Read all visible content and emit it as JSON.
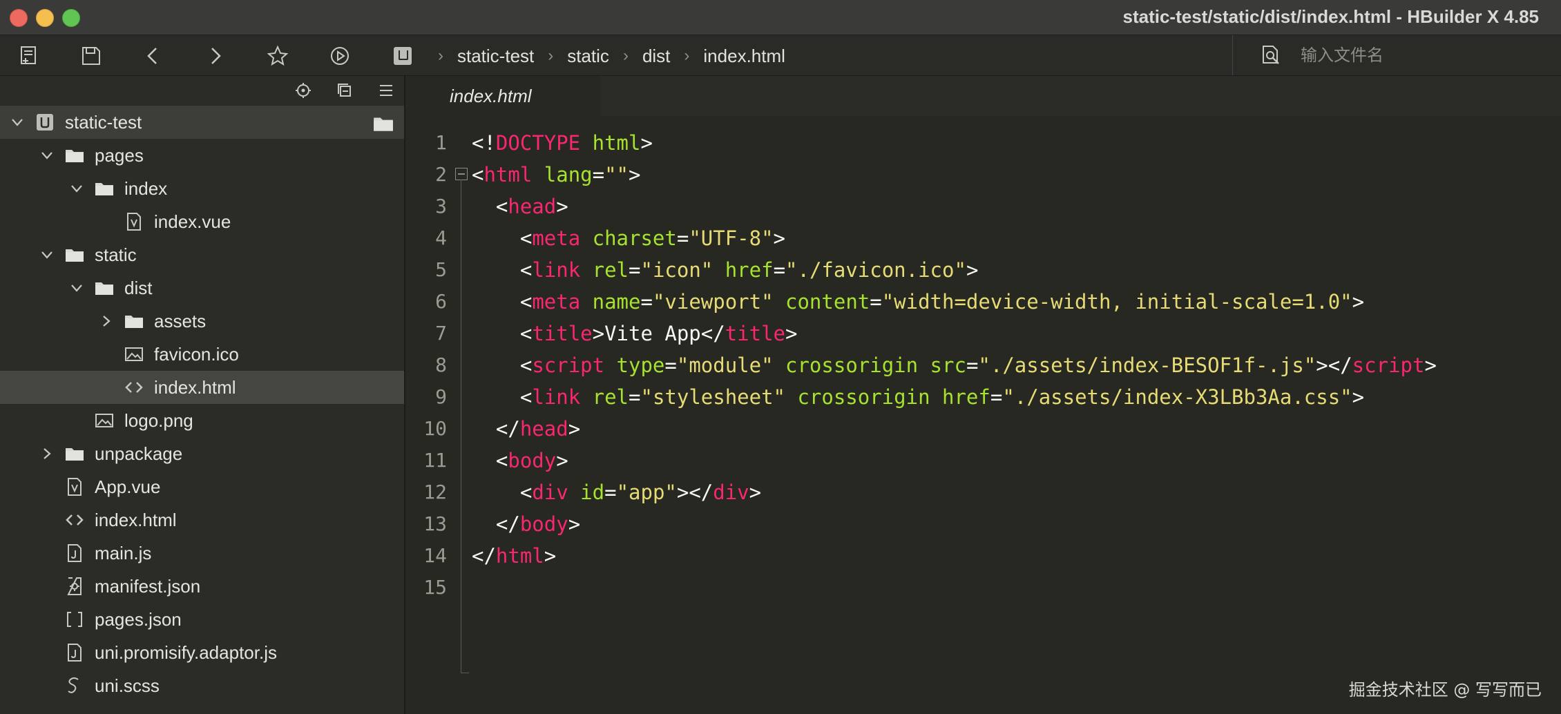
{
  "window": {
    "title": "static-test/static/dist/index.html - HBuilder X 4.85"
  },
  "toolbar": {
    "buttons": [
      "new-file-icon",
      "save-icon",
      "back-icon",
      "forward-icon",
      "star-icon",
      "run-icon"
    ],
    "breadcrumb": [
      "static-test",
      "static",
      "dist",
      "index.html"
    ],
    "search_placeholder": "输入文件名"
  },
  "sidebar": {
    "tree": [
      {
        "label": "static-test",
        "depth": 0,
        "type": "project",
        "expanded": true
      },
      {
        "label": "pages",
        "depth": 1,
        "type": "folder",
        "expanded": true
      },
      {
        "label": "index",
        "depth": 2,
        "type": "folder",
        "expanded": true
      },
      {
        "label": "index.vue",
        "depth": 3,
        "type": "vue"
      },
      {
        "label": "static",
        "depth": 1,
        "type": "folder",
        "expanded": true
      },
      {
        "label": "dist",
        "depth": 2,
        "type": "folder",
        "expanded": true
      },
      {
        "label": "assets",
        "depth": 3,
        "type": "folder",
        "expanded": false
      },
      {
        "label": "favicon.ico",
        "depth": 3,
        "type": "image"
      },
      {
        "label": "index.html",
        "depth": 3,
        "type": "html",
        "selected": true
      },
      {
        "label": "logo.png",
        "depth": 2,
        "type": "image"
      },
      {
        "label": "unpackage",
        "depth": 1,
        "type": "folder",
        "expanded": false
      },
      {
        "label": "App.vue",
        "depth": 1,
        "type": "vue"
      },
      {
        "label": "index.html",
        "depth": 1,
        "type": "html"
      },
      {
        "label": "main.js",
        "depth": 1,
        "type": "js"
      },
      {
        "label": "manifest.json",
        "depth": 1,
        "type": "manifest"
      },
      {
        "label": "pages.json",
        "depth": 1,
        "type": "json"
      },
      {
        "label": "uni.promisify.adaptor.js",
        "depth": 1,
        "type": "js"
      },
      {
        "label": "uni.scss",
        "depth": 1,
        "type": "scss"
      }
    ]
  },
  "editor": {
    "tab_label": "index.html",
    "line_numbers": [
      "1",
      "2",
      "3",
      "4",
      "5",
      "6",
      "7",
      "8",
      "9",
      "10",
      "11",
      "12",
      "13",
      "14",
      "15"
    ],
    "lines": [
      {
        "indent": 0,
        "tokens": [
          [
            "p",
            "<!"
          ],
          [
            "tg",
            "DOCTYPE"
          ],
          [
            "p",
            " "
          ],
          [
            "at",
            "html"
          ],
          [
            "p",
            ">"
          ]
        ]
      },
      {
        "indent": 0,
        "tokens": [
          [
            "p",
            "<"
          ],
          [
            "tg",
            "html"
          ],
          [
            "p",
            " "
          ],
          [
            "at",
            "lang"
          ],
          [
            "p",
            "="
          ],
          [
            "sv",
            "\"\""
          ],
          [
            "p",
            ">"
          ]
        ]
      },
      {
        "indent": 1,
        "tokens": [
          [
            "p",
            "<"
          ],
          [
            "tg",
            "head"
          ],
          [
            "p",
            ">"
          ]
        ]
      },
      {
        "indent": 2,
        "tokens": [
          [
            "p",
            "<"
          ],
          [
            "tg",
            "meta"
          ],
          [
            "p",
            " "
          ],
          [
            "at",
            "charset"
          ],
          [
            "p",
            "="
          ],
          [
            "sv",
            "\"UTF-8\""
          ],
          [
            "p",
            ">"
          ]
        ]
      },
      {
        "indent": 2,
        "tokens": [
          [
            "p",
            "<"
          ],
          [
            "tg",
            "link"
          ],
          [
            "p",
            " "
          ],
          [
            "at",
            "rel"
          ],
          [
            "p",
            "="
          ],
          [
            "sv",
            "\"icon\""
          ],
          [
            "p",
            " "
          ],
          [
            "at",
            "href"
          ],
          [
            "p",
            "="
          ],
          [
            "sv",
            "\"./favicon.ico\""
          ],
          [
            "p",
            ">"
          ]
        ]
      },
      {
        "indent": 2,
        "tokens": [
          [
            "p",
            "<"
          ],
          [
            "tg",
            "meta"
          ],
          [
            "p",
            " "
          ],
          [
            "at",
            "name"
          ],
          [
            "p",
            "="
          ],
          [
            "sv",
            "\"viewport\""
          ],
          [
            "p",
            " "
          ],
          [
            "at",
            "content"
          ],
          [
            "p",
            "="
          ],
          [
            "sv",
            "\"width=device-width, initial-scale=1.0\""
          ],
          [
            "p",
            ">"
          ]
        ]
      },
      {
        "indent": 2,
        "tokens": [
          [
            "p",
            "<"
          ],
          [
            "tg",
            "title"
          ],
          [
            "p",
            ">Vite App</"
          ],
          [
            "tg",
            "title"
          ],
          [
            "p",
            ">"
          ]
        ]
      },
      {
        "indent": 2,
        "tokens": [
          [
            "p",
            "<"
          ],
          [
            "tg",
            "script"
          ],
          [
            "p",
            " "
          ],
          [
            "at",
            "type"
          ],
          [
            "p",
            "="
          ],
          [
            "sv",
            "\"module\""
          ],
          [
            "p",
            " "
          ],
          [
            "at",
            "crossorigin"
          ],
          [
            "p",
            " "
          ],
          [
            "at",
            "src"
          ],
          [
            "p",
            "="
          ],
          [
            "sv",
            "\"./assets/index-BESOF1f-.js\""
          ],
          [
            "p",
            "></"
          ],
          [
            "tg",
            "script"
          ],
          [
            "p",
            ">"
          ]
        ]
      },
      {
        "indent": 2,
        "tokens": [
          [
            "p",
            "<"
          ],
          [
            "tg",
            "link"
          ],
          [
            "p",
            " "
          ],
          [
            "at",
            "rel"
          ],
          [
            "p",
            "="
          ],
          [
            "sv",
            "\"stylesheet\""
          ],
          [
            "p",
            " "
          ],
          [
            "at",
            "crossorigin"
          ],
          [
            "p",
            " "
          ],
          [
            "at",
            "href"
          ],
          [
            "p",
            "="
          ],
          [
            "sv",
            "\"./assets/index-X3LBb3Aa.css\""
          ],
          [
            "p",
            ">"
          ]
        ]
      },
      {
        "indent": 1,
        "tokens": [
          [
            "p",
            "</"
          ],
          [
            "tg",
            "head"
          ],
          [
            "p",
            ">"
          ]
        ]
      },
      {
        "indent": 1,
        "tokens": [
          [
            "p",
            "<"
          ],
          [
            "tg",
            "body"
          ],
          [
            "p",
            ">"
          ]
        ]
      },
      {
        "indent": 2,
        "tokens": [
          [
            "p",
            "<"
          ],
          [
            "tg",
            "div"
          ],
          [
            "p",
            " "
          ],
          [
            "at",
            "id"
          ],
          [
            "p",
            "="
          ],
          [
            "sv",
            "\"app\""
          ],
          [
            "p",
            "></"
          ],
          [
            "tg",
            "div"
          ],
          [
            "p",
            ">"
          ]
        ]
      },
      {
        "indent": 1,
        "tokens": [
          [
            "p",
            "</"
          ],
          [
            "tg",
            "body"
          ],
          [
            "p",
            ">"
          ]
        ]
      },
      {
        "indent": 0,
        "tokens": [
          [
            "p",
            "</"
          ],
          [
            "tg",
            "html"
          ],
          [
            "p",
            ">"
          ]
        ]
      },
      {
        "indent": 0,
        "tokens": []
      }
    ]
  },
  "watermark": "掘金技术社区 @ 写写而已",
  "colors": {
    "background": "#272822",
    "tag": "#f92672",
    "attribute": "#a6e22e",
    "string": "#e6db74",
    "plain": "#f8f8f2"
  }
}
